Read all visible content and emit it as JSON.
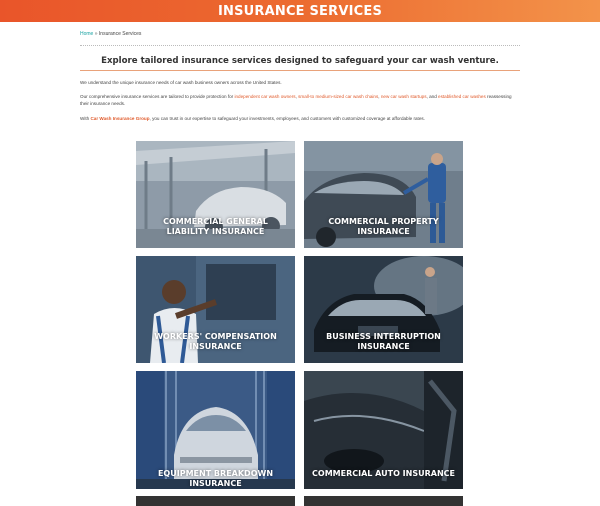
{
  "banner": {
    "title": "INSURANCE SERVICES"
  },
  "breadcrumb": {
    "home": "Home",
    "separator": "»",
    "current": "Insurance Services"
  },
  "intro": {
    "heading": "Explore tailored insurance services designed to safeguard your car wash venture.",
    "p1": "We understand the unique insurance needs of car wash business owners across the United States.",
    "p2_start": "Our comprehensive insurance services are tailored to provide protection for ",
    "p2_link1": "independent car wash owners",
    "p2_comma1": ", ",
    "p2_link2": "small-to medium-sized car wash chains",
    "p2_comma2": ", ",
    "p2_link3": "new car wash startups",
    "p2_and": ", and ",
    "p2_link4": "established car washes",
    "p2_end": " reassessing their insurance needs.",
    "p3_start": "With ",
    "p3_brand": "Car Wash Insurance Group",
    "p3_end": ", you can trust in our expertise to safeguard your investments, employees, and customers with customized coverage at affordable rates."
  },
  "services": [
    {
      "label_line1": "COMMERCIAL GENERAL",
      "label_line2": "LIABILITY INSURANCE"
    },
    {
      "label_line1": "COMMERCIAL PROPERTY",
      "label_line2": "INSURANCE"
    },
    {
      "label_line1": "WORKERS' COMPENSATION",
      "label_line2": "INSURANCE"
    },
    {
      "label_line1": "BUSINESS INTERRUPTION",
      "label_line2": "INSURANCE"
    },
    {
      "label_line1": "EQUIPMENT BREAKDOWN INSURANCE",
      "label_line2": ""
    },
    {
      "label_line1": "COMMERCIAL AUTO INSURANCE",
      "label_line2": ""
    }
  ],
  "colors": {
    "banner_start": "#e9552a",
    "banner_end": "#f3934a",
    "link_teal": "#1aa3a3",
    "accent_orange": "#e05a2b"
  }
}
